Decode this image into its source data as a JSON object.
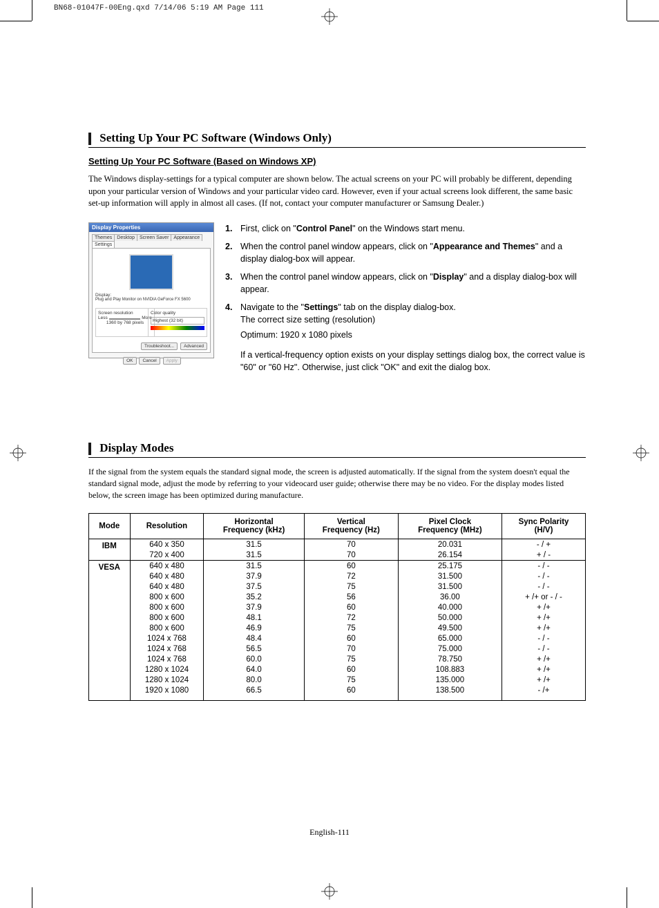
{
  "print_header": "BN68-01047F-00Eng.qxd  7/14/06  5:19 AM  Page 111",
  "section1": {
    "title": "Setting Up Your PC Software (Windows Only)",
    "subtitle": "Setting Up Your PC Software (Based on Windows XP)",
    "intro": "The Windows display-settings for a typical computer are shown below. The actual screens on your PC will probably be different, depending upon your particular version of Windows and your particular video card. However, even if your actual screens look different, the same basic set-up information will apply in almost all cases. (If not, contact your computer manufacturer or Samsung Dealer.)",
    "screenshot": {
      "title": "Display Properties",
      "tabs": [
        "Themes",
        "Desktop",
        "Screen Saver",
        "Appearance",
        "Settings"
      ],
      "display_label": "Display:",
      "display_value": "Plug and Play Monitor on NVIDIA GeForce FX 5600",
      "res_label": "Screen resolution",
      "res_less": "Less",
      "res_more": "More",
      "res_value": "1360 by 768 pixels",
      "color_label": "Color quality",
      "color_value": "Highest (32 bit)",
      "btn_troubleshoot": "Troubleshoot...",
      "btn_advanced": "Advanced",
      "btn_ok": "OK",
      "btn_cancel": "Cancel",
      "btn_apply": "Apply"
    },
    "steps": [
      {
        "n": "1.",
        "pre": "First, click on \"",
        "b": "Control Panel",
        "post": "\" on the Windows start menu."
      },
      {
        "n": "2.",
        "pre": "When the control panel window appears, click on \"",
        "b": "Appearance and Themes",
        "post": "\" and a display dialog-box will appear."
      },
      {
        "n": "3.",
        "pre": "When the control panel window appears, click on \"",
        "b": "Display",
        "post": "\" and a display dialog-box will appear."
      },
      {
        "n": "4.",
        "pre": "Navigate to the \"",
        "b": "Settings",
        "post": "\" tab on the display dialog-box.",
        "line2": "The correct size setting (resolution)",
        "line3": "Optimum: 1920 x 1080 pixels",
        "line4": "If a vertical-frequency option exists on your display settings dialog box, the correct value is \"60\" or \"60 Hz\". Otherwise, just click \"OK\" and exit the dialog box."
      }
    ]
  },
  "section2": {
    "title": "Display Modes",
    "intro": "If the signal from the system equals the standard signal mode, the screen is adjusted automatically.  If the signal from the system doesn't equal the standard signal mode, adjust the mode by referring to your videocard user guide; otherwise there may be no video. For the display modes listed below, the screen image has been optimized during manufacture."
  },
  "table": {
    "headers": [
      "Mode",
      "Resolution",
      "Horizontal Frequency (kHz)",
      "Vertical Frequency (Hz)",
      "Pixel Clock Frequency (MHz)",
      "Sync Polarity (H/V)"
    ],
    "groups": [
      {
        "mode": "IBM",
        "rows": [
          [
            "640 x 350",
            "31.5",
            "70",
            "20.031",
            "- / +"
          ],
          [
            "720 x 400",
            "31.5",
            "70",
            "26.154",
            "+ / -"
          ]
        ]
      },
      {
        "mode": "VESA",
        "rows": [
          [
            "640 x 480",
            "31.5",
            "60",
            "25.175",
            "- / -"
          ],
          [
            "640 x 480",
            "37.9",
            "72",
            "31.500",
            "- / -"
          ],
          [
            "640 x 480",
            "37.5",
            "75",
            "31.500",
            "- / -"
          ],
          [
            "800 x 600",
            "35.2",
            "56",
            "36.00",
            "+ /+ or - / -"
          ],
          [
            "800 x 600",
            "37.9",
            "60",
            "40.000",
            "+ /+"
          ],
          [
            "800 x 600",
            "48.1",
            "72",
            "50.000",
            "+ /+"
          ],
          [
            "800 x 600",
            "46.9",
            "75",
            "49.500",
            "+ /+"
          ],
          [
            "1024 x 768",
            "48.4",
            "60",
            "65.000",
            "- / -"
          ],
          [
            "1024 x 768",
            "56.5",
            "70",
            "75.000",
            "- / -"
          ],
          [
            "1024 x 768",
            "60.0",
            "75",
            "78.750",
            "+ /+"
          ],
          [
            "1280 x 1024",
            "64.0",
            "60",
            "108.883",
            "+ /+"
          ],
          [
            "1280 x 1024",
            "80.0",
            "75",
            "135.000",
            "+ /+"
          ],
          [
            "1920 x 1080",
            "66.5",
            "60",
            "138.500",
            "- /+"
          ]
        ]
      }
    ]
  },
  "footer": "English-111"
}
